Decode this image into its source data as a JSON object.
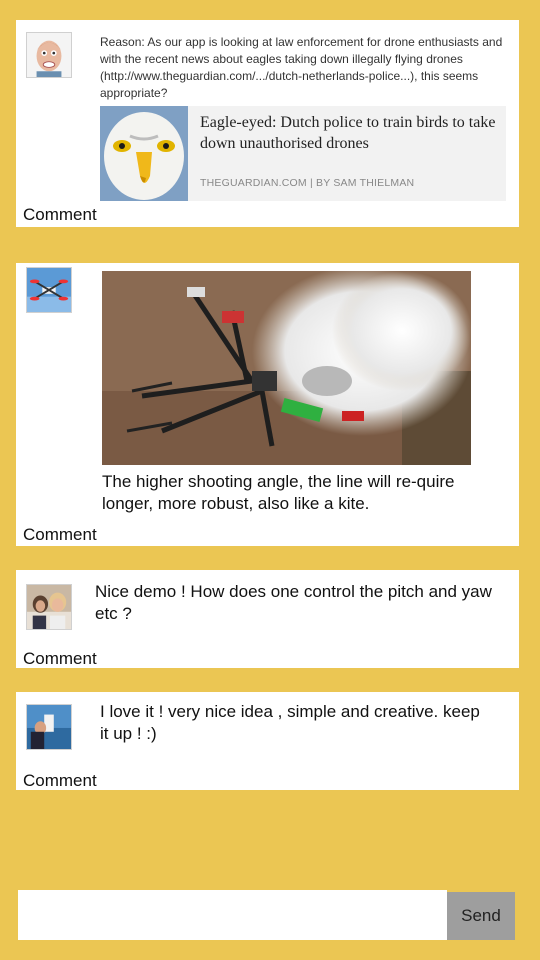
{
  "feed": {
    "posts": [
      {
        "share_text": "Reason: As our app is looking at law enforcement for drone enthusiasts and with the recent news about eagles taking down illegally flying drones (http://www.theguardian.com/.../dutch-netherlands-police...), this seems appropriate?",
        "link_title": "Eagle-eyed: Dutch police to train birds to take down unauthorised drones",
        "link_meta": "THEGUARDIAN.COM | BY SAM THIELMAN",
        "comment_label": "Comment"
      },
      {
        "text": "The higher shooting angle, the line will re-quire longer, more robust, also like a kite.",
        "comment_label": "Comment"
      },
      {
        "text": "Nice demo ! How does one control the pitch and yaw etc ?",
        "comment_label": "Comment"
      },
      {
        "text": "I love it ! very nice idea , simple and creative. keep it up ! :)",
        "comment_label": "Comment"
      }
    ]
  },
  "composer": {
    "placeholder": "",
    "send_label": "Send"
  },
  "colors": {
    "background": "#EBC653",
    "card": "#FFFFFF",
    "send_button": "#9E9E9E"
  }
}
